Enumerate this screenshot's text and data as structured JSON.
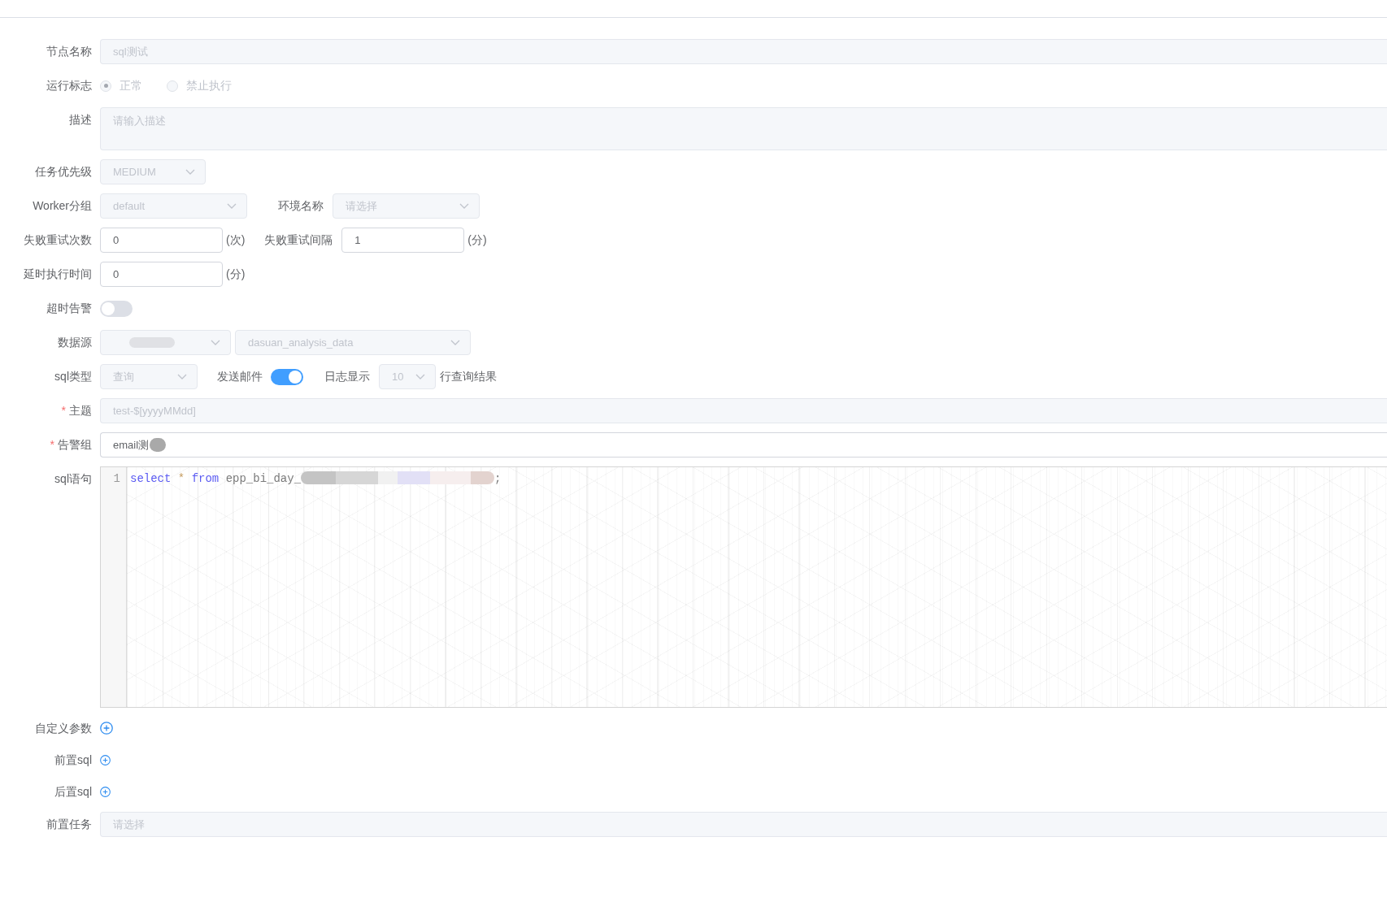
{
  "form": {
    "rows": [
      {
        "label": "节点名称",
        "items": [
          {
            "kind": "input",
            "value": "sql测试",
            "disabled": true
          }
        ]
      },
      {
        "label": "运行标志",
        "items": [
          {
            "kind": "radio",
            "disabled": true,
            "options": [
              {
                "label": "正常",
                "selected": true
              },
              {
                "label": "禁止执行",
                "selected": false
              }
            ]
          }
        ]
      },
      {
        "label": "描述",
        "items": [
          {
            "kind": "textarea",
            "placeholder": "请输入描述",
            "disabled": true
          }
        ]
      },
      {
        "label": "任务优先级",
        "items": [
          {
            "kind": "select",
            "value": "MEDIUM",
            "disabled": true
          }
        ]
      },
      {
        "label": "Worker分组",
        "items": [
          {
            "kind": "select",
            "value": "default",
            "disabled": true
          },
          {
            "kind": "label",
            "text": "环境名称"
          },
          {
            "kind": "select",
            "placeholder": "请选择",
            "disabled": true
          }
        ]
      },
      {
        "label": "失败重试次数",
        "items": [
          {
            "kind": "input",
            "value": "0",
            "disabled": false
          },
          {
            "kind": "unit",
            "text": "(次)"
          },
          {
            "kind": "label",
            "text": "失败重试间隔"
          },
          {
            "kind": "input",
            "value": "1",
            "disabled": false
          },
          {
            "kind": "unit",
            "text": "(分)"
          }
        ]
      },
      {
        "label": "延时执行时间",
        "items": [
          {
            "kind": "input",
            "value": "0",
            "disabled": false
          },
          {
            "kind": "unit",
            "text": "(分)"
          }
        ]
      },
      {
        "label": "超时告警",
        "items": [
          {
            "kind": "switch",
            "on": false
          }
        ]
      },
      {
        "label": "数据源",
        "items": [
          {
            "kind": "select",
            "redacted": true,
            "disabled": true
          },
          {
            "kind": "select",
            "value": "dasuan_analysis_data",
            "disabled": true
          }
        ]
      },
      {
        "label": "sql类型",
        "items": [
          {
            "kind": "select",
            "value": "查询",
            "disabled": true
          },
          {
            "kind": "label",
            "text": "发送邮件"
          },
          {
            "kind": "switch",
            "on": true
          },
          {
            "kind": "label",
            "text": "日志显示"
          },
          {
            "kind": "select",
            "value": "10",
            "disabled": true
          },
          {
            "kind": "text",
            "text": "行查询结果"
          }
        ]
      },
      {
        "label": "主题",
        "required_mark": "*",
        "items": [
          {
            "kind": "input",
            "value": "test-$[yyyyMMdd]",
            "disabled": true
          }
        ]
      },
      {
        "label": "告警组",
        "required_mark": "*",
        "items": [
          {
            "kind": "input",
            "value": "email测",
            "redacted": true,
            "disabled": false
          }
        ]
      },
      {
        "label": "sql语句",
        "items": [
          {
            "kind": "editor",
            "lines": [
              {
                "number": "1",
                "tokens": [
                  {
                    "kind": "keyword",
                    "text": "select"
                  },
                  {
                    "kind": "operator",
                    "text": "*"
                  },
                  {
                    "kind": "keyword",
                    "text": "from"
                  },
                  {
                    "kind": "plain",
                    "text": "epp_bi_day_"
                  },
                  {
                    "kind": "redacted"
                  },
                  {
                    "kind": "plain",
                    "text": ";"
                  }
                ]
              }
            ]
          }
        ]
      },
      {
        "label": "自定义参数",
        "items": [
          {
            "kind": "add"
          }
        ]
      },
      {
        "label": "前置sql",
        "items": [
          {
            "kind": "add"
          }
        ]
      },
      {
        "label": "后置sql",
        "items": [
          {
            "kind": "add"
          }
        ]
      },
      {
        "label": "前置任务",
        "items": [
          {
            "kind": "input",
            "placeholder": "请选择",
            "disabled": true
          }
        ]
      }
    ]
  }
}
